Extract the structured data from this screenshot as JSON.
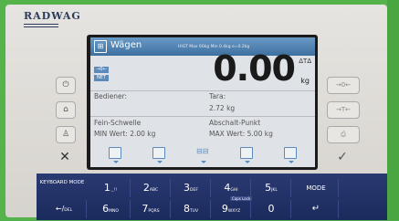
{
  "device": {
    "brand": "RADWAG"
  },
  "screen": {
    "title": "Wägen",
    "range_info": "HIGT Max 60kg Min 0.4kg e=0.2kg",
    "zero_flag": "→0←",
    "net_flag": "NET",
    "weight_value": "0.00",
    "unit": "kg",
    "stability": "ΔT∆",
    "fields": {
      "operator_label": "Bediener:",
      "tare_label": "Tara:",
      "tare_value": "2.72 kg",
      "fine_threshold_label": "Fein-Schwelle",
      "cutoff_label": "Abschalt-Punkt",
      "min_value": "MIN Wert: 2.00 kg",
      "max_value": "MAX Wert: 5.00 kg"
    }
  },
  "left_buttons": [
    {
      "name": "power-button",
      "icon": "power-icon"
    },
    {
      "name": "home-button",
      "icon": "home-icon"
    },
    {
      "name": "user-button",
      "icon": "user-icon"
    },
    {
      "name": "cancel-button",
      "icon": "x-icon"
    }
  ],
  "right_buttons": [
    {
      "name": "zero-button",
      "label": "→0←"
    },
    {
      "name": "tare-button",
      "label": "→T←"
    },
    {
      "name": "print-button",
      "icon": "printer-icon"
    },
    {
      "name": "enter-button",
      "icon": "check-icon"
    }
  ],
  "keyboard": {
    "mode_label": "KEYBOARD MODE",
    "keys_top": [
      {
        "main": "1",
        "sub": "._!!"
      },
      {
        "main": "2",
        "sub": "ABC"
      },
      {
        "main": "3",
        "sub": "DEF"
      },
      {
        "main": "4",
        "sub": "GHI"
      },
      {
        "main": "5",
        "sub": "JKL"
      },
      {
        "main": "MODE",
        "sub": ""
      }
    ],
    "keys_bottom": [
      {
        "main": "←/",
        "sub": "DEL"
      },
      {
        "main": "6",
        "sub": "MNO"
      },
      {
        "main": "7",
        "sub": "PQRS"
      },
      {
        "main": "8",
        "sub": "TUV"
      },
      {
        "main": "9",
        "sub": "WXYZ"
      },
      {
        "main": "0",
        "sub": ""
      }
    ],
    "caps_lock": "Caps Lock"
  },
  "colors": {
    "titlebar": "#3d6f9f",
    "keyboard": "#1b2a5c",
    "frame": "#56b24a"
  }
}
